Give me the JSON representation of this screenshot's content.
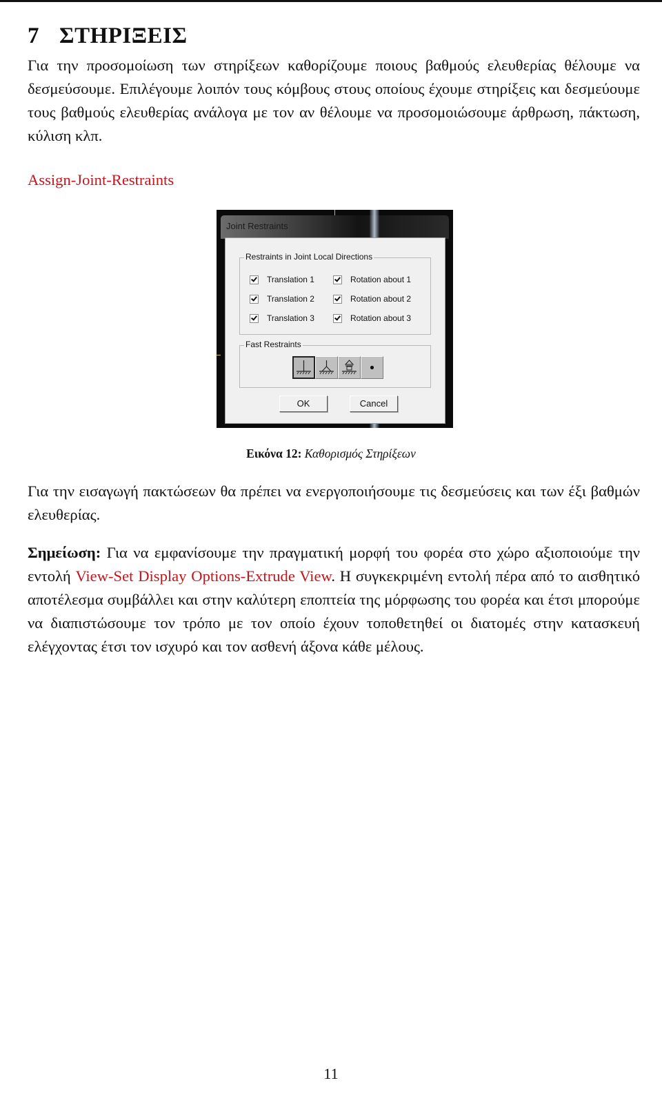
{
  "section": {
    "number": "7",
    "title": "ΣΤΗΡΙΞΕΙΣ"
  },
  "intro_paragraph": "Για την προσομοίωση των στηρίξεων καθορίζουμε ποιους βαθμούς ελευθερίας θέλουμε να δεσμεύσουμε. Επιλέγουμε λοιπόν τους κόμβους στους οποίους έχουμε στηρίξεις και δεσμεύουμε τους βαθμούς ελευθερίας ανάλογα με τον αν θέλουμε να προσομοιώσουμε άρθρωση, πάκτωση, κύλιση κλπ.",
  "command_path": "Assign-Joint-Restraints",
  "dialog": {
    "title": "Joint Restraints",
    "restraints_group_label": "Restraints in Joint Local Directions",
    "checkboxes": [
      {
        "label": "Translation  1",
        "checked": true
      },
      {
        "label": "Translation  2",
        "checked": true
      },
      {
        "label": "Translation  3",
        "checked": true
      },
      {
        "label": "Rotation about  1",
        "checked": true
      },
      {
        "label": "Rotation about  2",
        "checked": true
      },
      {
        "label": "Rotation about  3",
        "checked": true
      }
    ],
    "fast_group_label": "Fast Restraints",
    "fast_restraints": [
      {
        "icon": "fixed-support-icon",
        "selected": true
      },
      {
        "icon": "pinned-support-icon",
        "selected": false
      },
      {
        "icon": "roller-support-icon",
        "selected": false
      },
      {
        "icon": "free-joint-icon",
        "selected": false
      }
    ],
    "ok_label": "OK",
    "cancel_label": "Cancel"
  },
  "figure_caption": {
    "label": "Εικόνα 12:",
    "text": "Καθορισμός Στηρίξεων"
  },
  "fixity_paragraph": "Για την εισαγωγή πακτώσεων θα πρέπει να ενεργοποιήσουμε τις δεσμεύσεις και των έξι βαθμών ελευθερίας.",
  "note": {
    "label": "Σημείωση:",
    "text_before": " Για να εμφανίσουμε την πραγματική μορφή του φορέα στο χώρο αξιοποιούμε την εντολή ",
    "command": "View-Set Display Options-Extrude View",
    "text_after": ". Η συγκεκριμένη εντολή πέρα από το αισθητικό αποτέλεσμα συμβάλλει και στην καλύτερη εποπτεία της μόρφωσης του φορέα και έτσι μπορούμε να διαπιστώσουμε τον τρόπο με τον οποίο έχουν τοποθετηθεί οι διατομές στην κατασκευή ελέγχοντας έτσι τον ισχυρό και τον ασθενή άξονα κάθε μέλους."
  },
  "page_number": "11",
  "colors": {
    "command_red": "#c0161c",
    "text": "#111111"
  }
}
